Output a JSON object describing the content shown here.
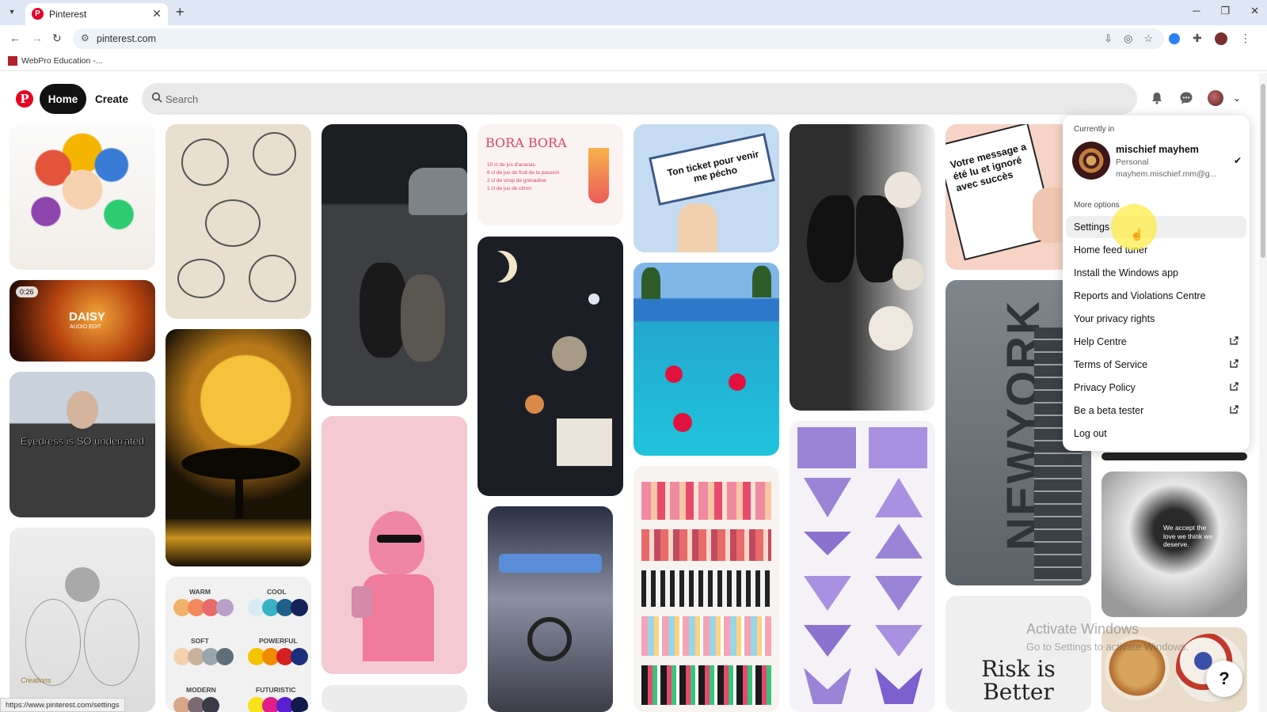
{
  "browser": {
    "tab_title": "Pinterest",
    "url": "pinterest.com",
    "bookmark": "WebPro Education -...",
    "status_url": "https://www.pinterest.com/settings"
  },
  "header": {
    "home_label": "Home",
    "create_label": "Create",
    "search_placeholder": "Search"
  },
  "pins": {
    "video_duration": "0:26",
    "daisy_title": "DAISY",
    "daisy_sub": "AUDIO EDIT",
    "eyedress_caption": "Eyedress is SO underrated",
    "bora_title": "BORA BORA",
    "bora_lines": [
      "10 cl de jus d'ananas",
      "6 cl de jus de fruit de la passion",
      "2 cl de sirop de grenadine",
      "1 cl de jus de citron"
    ],
    "ticket_text": "Ton ticket pour venir me pécho",
    "message_text": "Votre message a été lu et ignoré avec succès",
    "newyork_text": "NEWYORK",
    "palette_labels": [
      "WARM",
      "COOL",
      "SOFT",
      "POWERFUL",
      "MODERN",
      "FUTURISTIC"
    ],
    "risk_text": "Risk is Better",
    "love_text": "We accept the love we think we deserve.",
    "creators_text": "Creations"
  },
  "dropdown": {
    "currently_in": "Currently in",
    "account_name": "mischief mayhem",
    "account_type": "Personal",
    "account_email": "mayhem.mischief.mm@g...",
    "more_options": "More options",
    "items": [
      {
        "label": "Settings",
        "external": false
      },
      {
        "label": "Home feed tuner",
        "external": false
      },
      {
        "label": "Install the Windows app",
        "external": false
      },
      {
        "label": "Reports and Violations Centre",
        "external": false
      },
      {
        "label": "Your privacy rights",
        "external": false
      },
      {
        "label": "Help Centre",
        "external": true
      },
      {
        "label": "Terms of Service",
        "external": true
      },
      {
        "label": "Privacy Policy",
        "external": true
      },
      {
        "label": "Be a beta tester",
        "external": true
      },
      {
        "label": "Log out",
        "external": false
      }
    ]
  },
  "watermark": {
    "title": "Activate Windows",
    "subtitle": "Go to Settings to activate Windows."
  },
  "help_label": "?",
  "colors": {
    "brand": "#e60023",
    "selected_item_bg": "#efefef",
    "cursor_highlight": "#ffec3c"
  }
}
